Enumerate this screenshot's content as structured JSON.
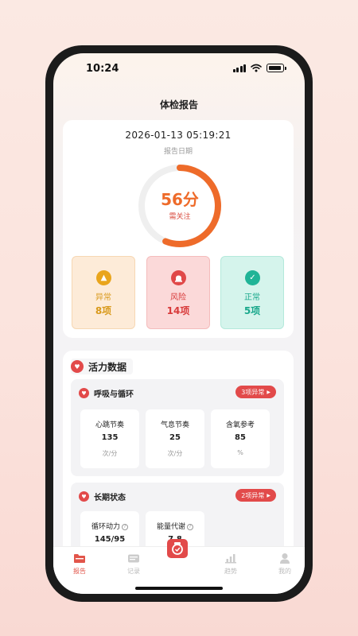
{
  "status_bar": {
    "time": "10:24"
  },
  "page_title": "体检报告",
  "summary": {
    "datetime": "2026-01-13 05:19:21",
    "date_label": "报告日期",
    "score": "56分",
    "score_fraction": 0.56,
    "score_status": "需关注",
    "stats": [
      {
        "label": "异常",
        "value": "8项",
        "icon": "warning-icon"
      },
      {
        "label": "风险",
        "value": "14项",
        "icon": "alarm-icon"
      },
      {
        "label": "正常",
        "value": "5项",
        "icon": "check-icon"
      }
    ]
  },
  "vitals": {
    "title": "活力数据",
    "groups": [
      {
        "title": "呼吸与循环",
        "alert": "3项异常",
        "metrics": [
          {
            "label": "心跳节奏",
            "value": "135",
            "unit": "次/分"
          },
          {
            "label": "气息节奏",
            "value": "25",
            "unit": "次/分"
          },
          {
            "label": "含氧参考",
            "value": "85",
            "unit": "%"
          }
        ]
      },
      {
        "title": "长期状态",
        "alert": "2项异常",
        "metrics": [
          {
            "label": "循环动力",
            "value": "145/95"
          },
          {
            "label": "能量代谢",
            "value": "7.8"
          }
        ]
      }
    ]
  },
  "tabs": [
    {
      "label": "报告",
      "icon": "folder-icon",
      "active": true
    },
    {
      "label": "记录",
      "icon": "record-icon"
    },
    {
      "label": "",
      "icon": "camera-icon"
    },
    {
      "label": "趋势",
      "icon": "chart-icon"
    },
    {
      "label": "我的",
      "icon": "user-icon"
    }
  ],
  "colors": {
    "accent": "#e24a4a",
    "score_orange": "#ee6b2a",
    "warning": "#e9a51c",
    "normal": "#20b497"
  }
}
